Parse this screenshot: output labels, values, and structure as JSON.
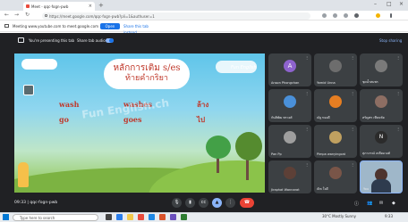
{
  "browser": {
    "tab_title": "Meet - qqc-fogn-pwb",
    "url": "https://meet.google.com/qqc-fogn-pwb?pli=1&authuser=1",
    "infobar_text": "Meeting www.youtube.com to meet.google.com",
    "open_button": "Open",
    "share_button": "Share this tab instead"
  },
  "meet": {
    "presenting_text": "You're presenting this tab",
    "share_audio_label": "Share tab audio",
    "stop_label": "Stop sharing",
    "meeting_time": "09:33",
    "meeting_code": "qqc-fogn-pwb",
    "control_icons": [
      "mic-icon",
      "camera-icon",
      "captions-icon",
      "present-icon",
      "more-icon",
      "end-call-icon"
    ]
  },
  "slide": {
    "title_line1": "หลักการเติม s/es",
    "title_line2": "ท้ายคำกริยา",
    "corner_text": "Fun English",
    "row1": [
      "wash",
      "washes",
      "ล้าง"
    ],
    "row2": [
      "go",
      "goes",
      "ไป"
    ],
    "watermark": "Fun English.ch"
  },
  "participants": [
    {
      "name": "Anson Phongchan",
      "initial": "A",
      "color": "#8e63ce"
    },
    {
      "name": "Yamid Unna",
      "initial": "",
      "color": "#6d6d6d"
    },
    {
      "name": "ชุดน้ำสมพร",
      "initial": "",
      "color": "#7a7a7a"
    },
    {
      "name": "กันติพัฒ พรวงศ์",
      "initial": "",
      "color": "#4a90d9"
    },
    {
      "name": "ณัฐ ทองดี",
      "initial": "",
      "color": "#e67e22"
    },
    {
      "name": "สรัญพร เทียนชัย",
      "initial": "",
      "color": "#8d6e63"
    },
    {
      "name": "Pan Pp",
      "initial": "",
      "color": "#9e9e9e"
    },
    {
      "name": "Pimpa wanyingcat",
      "initial": "",
      "color": "#c0a060"
    },
    {
      "name": "สุภาภรณ์ เหลียมวงศ์",
      "initial": "N",
      "color": "#2b2b2b"
    },
    {
      "name": "Jiraphat Wannarat",
      "initial": "",
      "color": "#5d4037"
    },
    {
      "name": "ณิช ใจดี",
      "initial": "",
      "color": "#795548"
    },
    {
      "name": "You",
      "initial": "",
      "color": "#9fb7c9"
    }
  ],
  "taskbar": {
    "search_placeholder": "Type here to search",
    "weather": "30°C Mostly Sunny",
    "clock": "9:33"
  }
}
